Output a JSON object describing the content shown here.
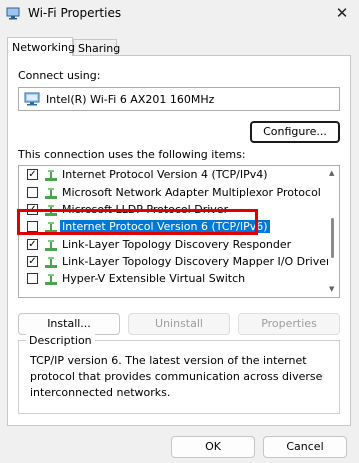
{
  "window": {
    "title": "Wi-Fi Properties",
    "close_glyph": "✕"
  },
  "tabs": [
    {
      "label": "Networking",
      "active": true
    },
    {
      "label": "Sharing",
      "active": false
    }
  ],
  "connect_using": {
    "label": "Connect using:",
    "adapter": "Intel(R) Wi-Fi 6 AX201 160MHz"
  },
  "configure_button": "Configure...",
  "items_label": "This connection uses the following items:",
  "items": [
    {
      "label": "Internet Protocol Version 4 (TCP/IPv4)",
      "checked": true,
      "selected": false
    },
    {
      "label": "Microsoft Network Adapter Multiplexor Protocol",
      "checked": false,
      "selected": false
    },
    {
      "label": "Microsoft LLDP Protocol Driver",
      "checked": true,
      "selected": false
    },
    {
      "label": "Internet Protocol Version 6 (TCP/IPv6)",
      "checked": false,
      "selected": true
    },
    {
      "label": "Link-Layer Topology Discovery Responder",
      "checked": true,
      "selected": false
    },
    {
      "label": "Link-Layer Topology Discovery Mapper I/O Driver",
      "checked": true,
      "selected": false
    },
    {
      "label": "Hyper-V Extensible Virtual Switch",
      "checked": false,
      "selected": false
    }
  ],
  "item_buttons": {
    "install": "Install...",
    "uninstall": "Uninstall",
    "properties": "Properties"
  },
  "description": {
    "legend": "Description",
    "text": "TCP/IP version 6. The latest version of the internet protocol that provides communication across diverse interconnected networks."
  },
  "footer": {
    "ok": "OK",
    "cancel": "Cancel"
  },
  "colors": {
    "selection": "#0078d7",
    "annotation_border": "#e00000",
    "panel_bg": "#ffffff",
    "window_bg": "#f0f0f0"
  },
  "icons": {
    "title": "network-adapter-icon",
    "adapter": "network-card-icon",
    "item": "network-component-icon"
  }
}
